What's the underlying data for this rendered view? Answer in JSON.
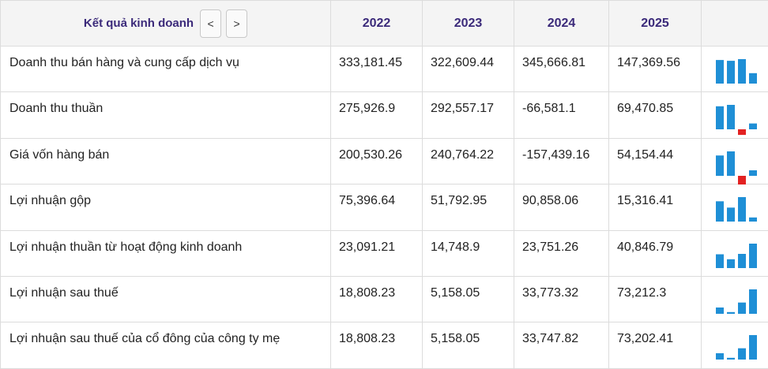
{
  "header": {
    "title": "Kết quả kinh doanh",
    "prev_label": "<",
    "next_label": ">",
    "years": [
      "2022",
      "2023",
      "2024",
      "2025"
    ]
  },
  "colors": {
    "positive": "#1f8fd6",
    "negative": "#e32222"
  },
  "rows": [
    {
      "name": "Doanh thu bán hàng và cung cấp dịch vụ",
      "values": [
        "333,181.45",
        "322,609.44",
        "345,666.81",
        "147,369.56"
      ],
      "numbers": [
        333181.45,
        322609.44,
        345666.81,
        147369.56
      ]
    },
    {
      "name": "Doanh thu thuần",
      "values": [
        "275,926.9",
        "292,557.17",
        "-66,581.1",
        "69,470.85"
      ],
      "numbers": [
        275926.9,
        292557.17,
        -66581.1,
        69470.85
      ]
    },
    {
      "name": "Giá vốn hàng bán",
      "values": [
        "200,530.26",
        "240,764.22",
        "-157,439.16",
        "54,154.44"
      ],
      "numbers": [
        200530.26,
        240764.22,
        -157439.16,
        54154.44
      ]
    },
    {
      "name": "Lợi nhuận gộp",
      "values": [
        "75,396.64",
        "51,792.95",
        "90,858.06",
        "15,316.41"
      ],
      "numbers": [
        75396.64,
        51792.95,
        90858.06,
        15316.41
      ]
    },
    {
      "name": "Lợi nhuận thuần từ hoạt động kinh doanh",
      "values": [
        "23,091.21",
        "14,748.9",
        "23,751.26",
        "40,846.79"
      ],
      "numbers": [
        23091.21,
        14748.9,
        23751.26,
        40846.79
      ]
    },
    {
      "name": "Lợi nhuận sau thuế",
      "values": [
        "18,808.23",
        "5,158.05",
        "33,773.32",
        "73,212.3"
      ],
      "numbers": [
        18808.23,
        5158.05,
        33773.32,
        73212.3
      ]
    },
    {
      "name": "Lợi nhuận sau thuế của cổ đông của công ty mẹ",
      "values": [
        "18,808.23",
        "5,158.05",
        "33,747.82",
        "73,202.41"
      ],
      "numbers": [
        18808.23,
        5158.05,
        33747.82,
        73202.41
      ]
    }
  ]
}
